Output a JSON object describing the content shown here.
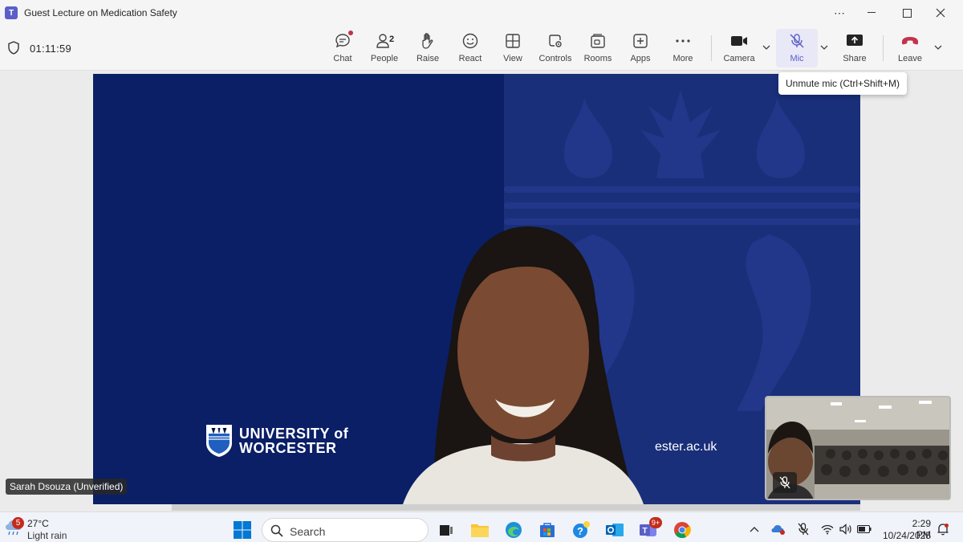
{
  "window": {
    "title": "Guest Lecture on Medication Safety",
    "controls": [
      "more",
      "minimize",
      "maximize",
      "close"
    ]
  },
  "toolbar": {
    "timer": "01:11:59",
    "buttons": {
      "chat": "Chat",
      "people": "People",
      "people_count": "2",
      "raise": "Raise",
      "react": "React",
      "view": "View",
      "controls": "Controls",
      "rooms": "Rooms",
      "apps": "Apps",
      "more": "More",
      "camera": "Camera",
      "mic": "Mic",
      "share": "Share",
      "leave": "Leave"
    },
    "tooltip": "Unmute mic (Ctrl+Shift+M)"
  },
  "stage": {
    "logo_line1": "UNIVERSITY of",
    "logo_line2": "WORCESTER",
    "url_fragment": "ester.ac.uk",
    "speaker_label": "Sarah Dsouza (Unverified)"
  },
  "taskbar": {
    "weather_badge": "5",
    "weather_temp": "27°C",
    "weather_desc": "Light rain",
    "search_placeholder": "Search",
    "teams_badge": "9+",
    "time": "2:29 PM",
    "date": "10/24/2025"
  },
  "colors": {
    "accent": "#5b5fc7",
    "leave_red": "#c4314b",
    "stage_blue": "#0a1f66"
  }
}
